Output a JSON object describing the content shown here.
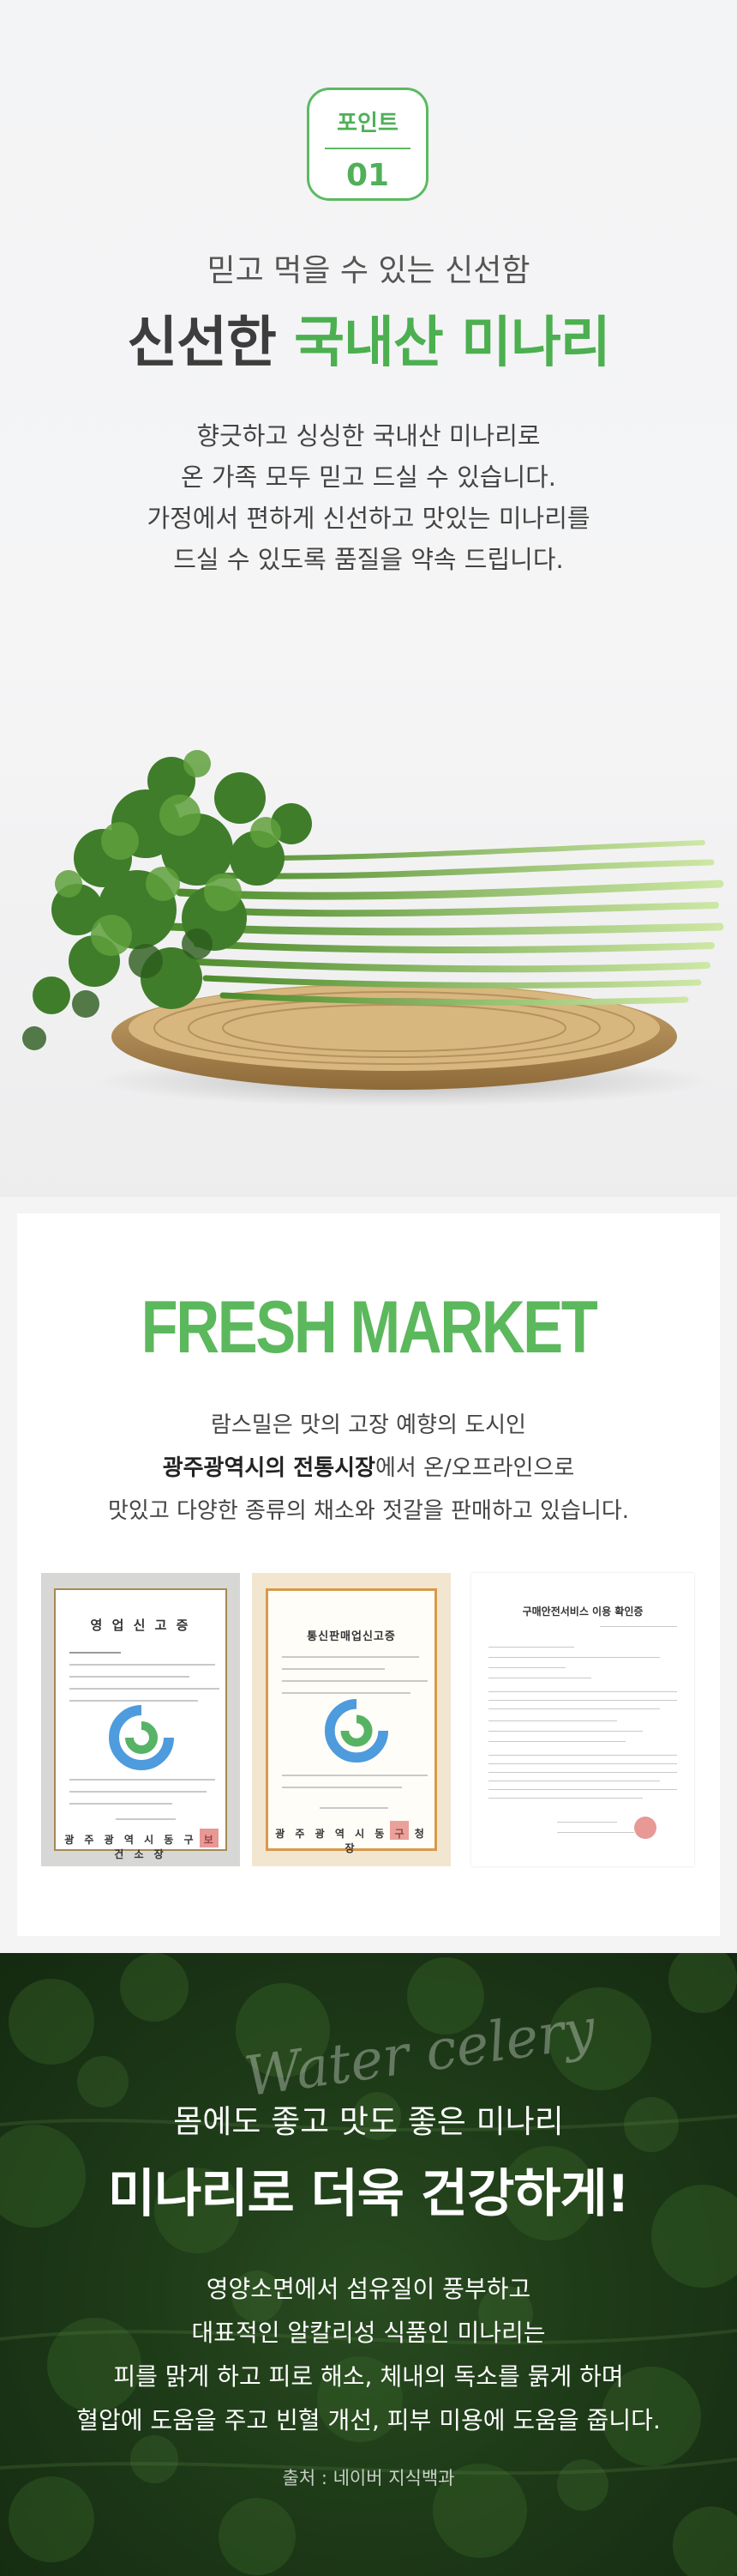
{
  "point": {
    "label": "포인트",
    "number": "01"
  },
  "intro": {
    "subtitle": "믿고 먹을 수 있는 신선함",
    "title_prefix": "신선한",
    "title_highlight": "국내산 미나리",
    "description": [
      "향긋하고 싱싱한 국내산 미나리로",
      "온 가족 모두 믿고 드실 수 있습니다.",
      "가정에서 편하게 신선하고 맛있는 미나리를",
      "드실 수 있도록 품질을 약속 드립니다."
    ]
  },
  "market": {
    "title": "FRESH MARKET",
    "line1": "람스밀은 맛의 고장 예향의 도시인",
    "line2_bold": "광주광역시의 전통시장",
    "line2_rest": "에서 온/오프라인으로",
    "line3": "맛있고 다양한 종류의 채소와 젓갈을 판매하고 있습니다."
  },
  "certificates": {
    "cert1_title": "영 업 신 고 증",
    "cert1_issuer": "광 주 광 역 시 동 구 보 건 소 장",
    "cert2_title": "통신판매업신고증",
    "cert2_issuer": "광 주 광 역 시 동 구 청 장",
    "cert3_title": "구매안전서비스 이용 확인증"
  },
  "health": {
    "script": "Water celery",
    "subtitle": "몸에도 좋고 맛도 좋은 미나리",
    "title": "미나리로 더욱 건강하게!",
    "description": [
      "영양소면에서 섬유질이 풍부하고",
      "대표적인 알칼리성 식품인 미나리는",
      "피를 맑게 하고 피로 해소, 체내의 독소를 묽게 하며",
      "혈압에 도움을 주고 빈혈 개선, 피부 미용에 도움을 줍니다."
    ],
    "source": "출처 : 네이버 지식백과"
  },
  "colors": {
    "accent_green": "#4caf50",
    "badge_green": "#5bba62",
    "fresh_market_green": "#5cb85c",
    "dark_text": "#3d3d3d"
  }
}
